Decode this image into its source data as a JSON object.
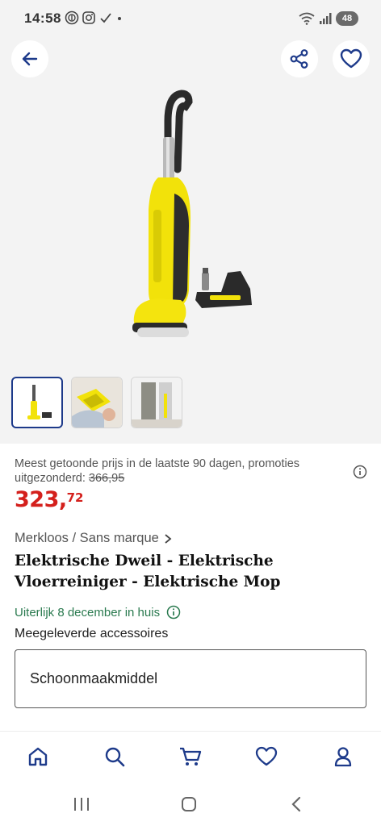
{
  "status_bar": {
    "time": "14:58",
    "battery": "48"
  },
  "header": {
    "back_icon": "arrow-left-icon",
    "share_icon": "share-icon",
    "favorite_icon": "heart-icon"
  },
  "gallery": {
    "thumbnails": [
      {
        "name": "thumbnail-1",
        "selected": true
      },
      {
        "name": "thumbnail-2",
        "selected": false
      },
      {
        "name": "thumbnail-3",
        "selected": false
      }
    ]
  },
  "pricing": {
    "note": "Meest getoonde prijs in de laatste 90 dagen, promoties uitgezonderd:",
    "reference_price": "366,95",
    "price_int": "323,",
    "price_dec": "72",
    "price_color": "#d4201c"
  },
  "product": {
    "brand": "Merkloos / Sans marque",
    "title": "Elektrische Dweil - Elektrische Vloerreiniger - Elektrische Mop",
    "delivery": "Uiterlijk 8 december in huis",
    "delivery_color": "#2a7a4f",
    "accessories_label": "Meegeleverde accessoires",
    "accessories_value": "Schoonmaakmiddel"
  },
  "bottom_nav": {
    "items": [
      "home-icon",
      "search-icon",
      "cart-icon",
      "heart-icon",
      "account-icon"
    ],
    "accent": "#1d3a8a"
  }
}
